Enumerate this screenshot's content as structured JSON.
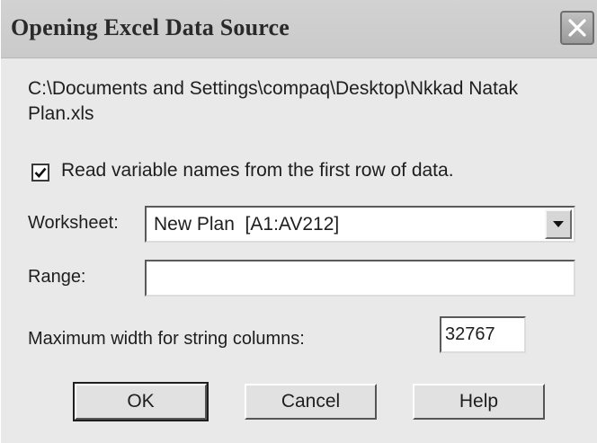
{
  "window": {
    "title": "Opening Excel Data Source",
    "close_icon": "close-icon"
  },
  "file_path": "C:\\Documents and Settings\\compaq\\Desktop\\Nkkad Natak Plan.xls",
  "read_names": {
    "checked": true,
    "label": "Read variable names from the first row of data."
  },
  "worksheet": {
    "label": "Worksheet:",
    "selected": "New Plan  [A1:AV212]",
    "arrow_icon": "chevron-down-icon"
  },
  "range": {
    "label": "Range:",
    "value": ""
  },
  "max_width": {
    "label": "Maximum width for string columns:",
    "value": "32767"
  },
  "buttons": {
    "ok": "OK",
    "cancel": "Cancel",
    "help": "Help"
  }
}
